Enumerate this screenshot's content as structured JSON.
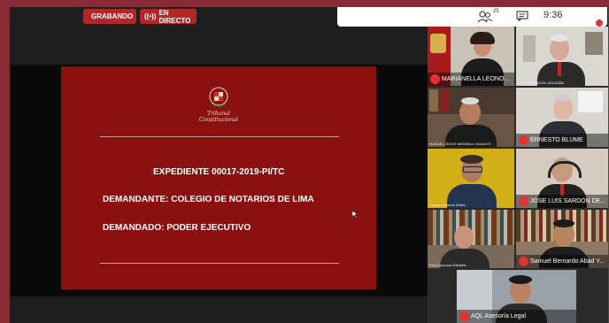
{
  "recording_badge": "GRABANDO",
  "live_badge": "EN DIRECTO",
  "status": {
    "participants_count": "25",
    "time": "9:36",
    "colors": {
      "accent": "#d23b3b"
    }
  },
  "slide": {
    "logo_text": "Tribunal Constitucional",
    "line1": "EXPEDIENTE 00017-2019-PI/TC",
    "line2": "DEMANDANTE:   COLEGIO DE NOTARIOS DE LIMA",
    "line3": "DEMANDADO: PODER EJECUTIVO"
  },
  "participants": [
    {
      "name": "MARIANELLA LEONOR L..."
    },
    {
      "name": "",
      "small_label": "ELOY ESPINOSA-SALDAÑA"
    },
    {
      "name": "",
      "small_label": "MANUEL JESUS MIRANDA CANALES"
    },
    {
      "name": "ERNESTO BLUME"
    },
    {
      "name": "",
      "small_label": "Augusto Ramos Núñez"
    },
    {
      "name": "JOSE LUIS SARDON DE..."
    },
    {
      "name": "",
      "small_label": "Eloy Espinosa-Saldaña"
    },
    {
      "name": "Samuel Bernardo Abad Y..."
    },
    {
      "name": "AQL Asesoría Legal"
    }
  ],
  "colors": {
    "frame_border": "#8a2a35",
    "slide_bg": "#8b1111",
    "badge_red": "#b3262a"
  }
}
